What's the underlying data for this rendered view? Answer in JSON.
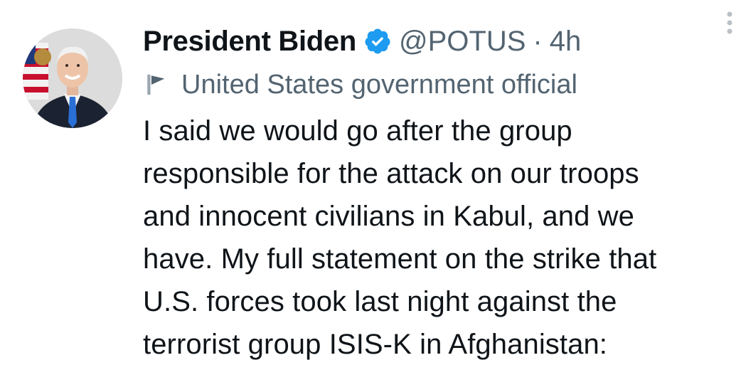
{
  "tweet": {
    "author": {
      "display_name": "President Biden",
      "handle": "@POTUS",
      "avatar_icon": "profile-photo",
      "verified_icon": "verified-badge-icon",
      "verified_color": "#1d9bf0"
    },
    "separator": "·",
    "timestamp": "4h",
    "label": {
      "icon": "flag-icon",
      "text": "United States government official"
    },
    "more_icon": "more-options-icon",
    "text": "I said we would go after the group\nresponsible for the attack on our troops\nand innocent civilians in Kabul, and we\nhave. My full statement on the strike that\nU.S. forces took last night against the\nterrorist group ISIS-K in Afghanistan:"
  },
  "colors": {
    "text_primary": "#0f1419",
    "text_secondary": "#536471",
    "background": "#ffffff"
  }
}
